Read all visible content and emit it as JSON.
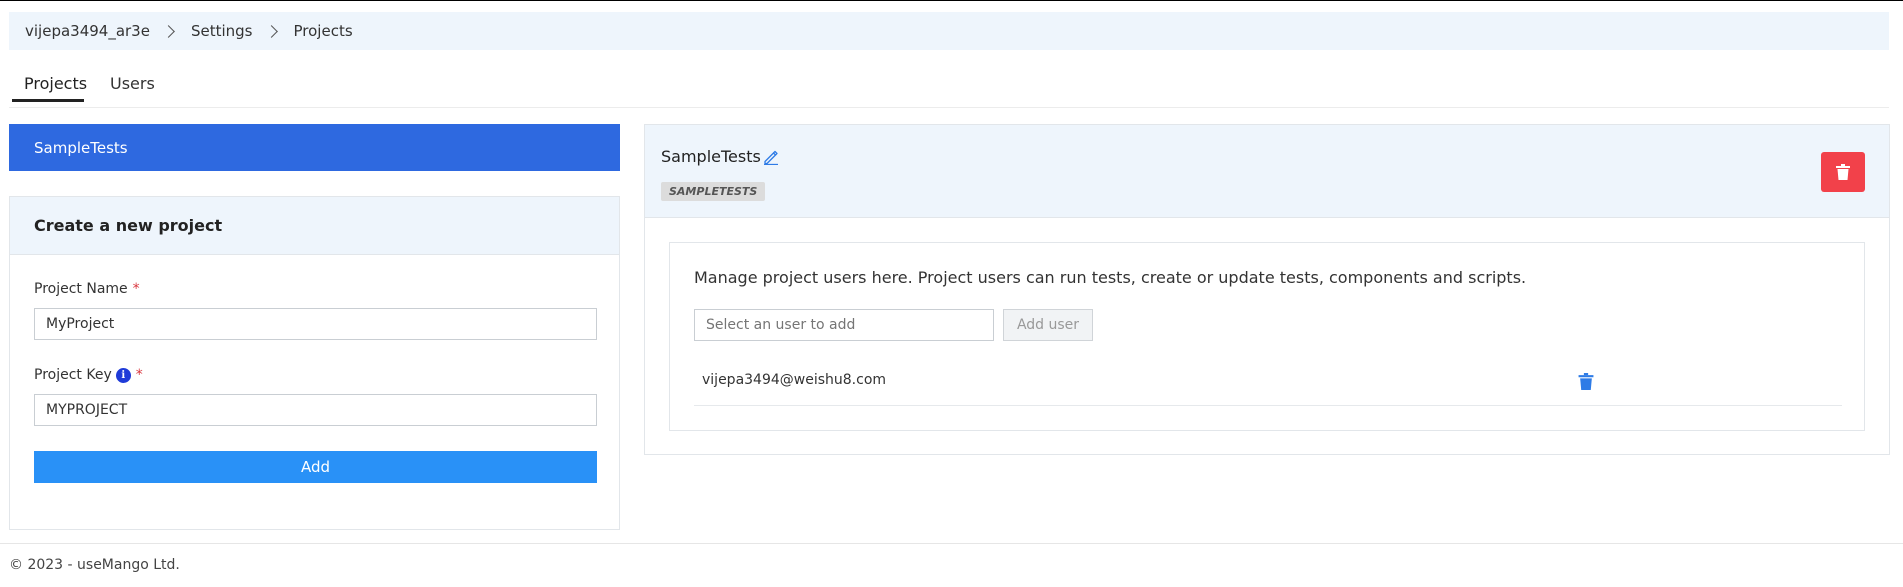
{
  "breadcrumb": {
    "items": [
      "vijepa3494_ar3e",
      "Settings",
      "Projects"
    ]
  },
  "tabs": [
    {
      "label": "Projects",
      "active": true
    },
    {
      "label": "Users",
      "active": false
    }
  ],
  "projects": {
    "items": [
      {
        "label": "SampleTests",
        "selected": true
      }
    ]
  },
  "create_project": {
    "title": "Create a new project",
    "name_label": "Project Name",
    "name_value": "MyProject",
    "key_label": "Project Key",
    "key_value": "MYPROJECT",
    "required_mark": "*",
    "info_icon": "i",
    "add_label": "Add"
  },
  "project_detail": {
    "title": "SampleTests",
    "key_tag": "SAMPLETESTS",
    "users_description": "Manage project users here. Project users can run tests, create or update tests, components and scripts.",
    "user_select_placeholder": "Select an user to add",
    "add_user_label": "Add user",
    "users": [
      {
        "email": "vijepa3494@weishu8.com"
      }
    ]
  },
  "footer": {
    "text": "© 2023 - useMango Ltd."
  },
  "colors": {
    "accent_blue": "#2e69e0",
    "button_blue": "#2991f7",
    "danger_red": "#f2414a",
    "header_bg": "#eef5fc"
  },
  "icons": [
    "chevron-right-icon",
    "info-icon",
    "edit-pencil-icon",
    "trash-icon"
  ]
}
